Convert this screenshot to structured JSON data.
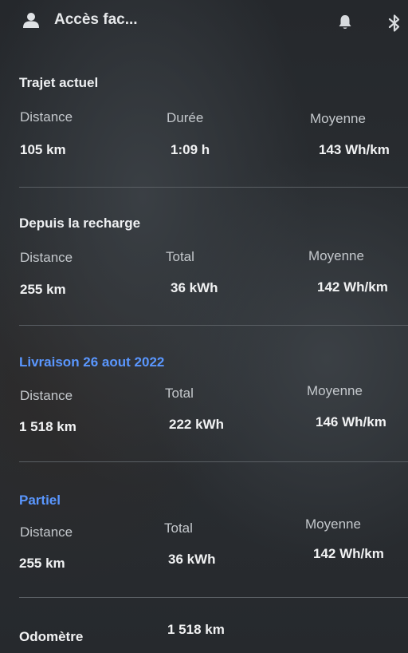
{
  "header": {
    "user_name": "Accès fac...",
    "icons": [
      "user-icon",
      "bell-icon",
      "bluetooth-icon"
    ]
  },
  "trip_current": {
    "title": "Trajet actuel",
    "col1_label": "Distance",
    "col2_label": "Durée",
    "col3_label": "Moyenne",
    "col1_value": "105 km",
    "col2_value": "1:09 h",
    "col3_value": "143 Wh/km"
  },
  "since_charge": {
    "title": "Depuis la recharge",
    "col1_label": "Distance",
    "col2_label": "Total",
    "col3_label": "Moyenne",
    "col1_value": "255 km",
    "col2_value": "36 kWh",
    "col3_value": "142 Wh/km"
  },
  "delivery": {
    "title": "Livraison 26 aout 2022",
    "col1_label": "Distance",
    "col2_label": "Total",
    "col3_label": "Moyenne",
    "col1_value": "1 518 km",
    "col2_value": "222 kWh",
    "col3_value": "146 Wh/km"
  },
  "partial": {
    "title": "Partiel",
    "col1_label": "Distance",
    "col2_label": "Total",
    "col3_label": "Moyenne",
    "col1_value": "255 km",
    "col2_value": "36 kWh",
    "col3_value": "142 Wh/km"
  },
  "odometer": {
    "label": "Odomètre",
    "value": "1 518 km"
  },
  "colors": {
    "accent_blue": "#5a97ff",
    "text_primary": "#eef0f2",
    "text_secondary": "#c4c8cc"
  }
}
